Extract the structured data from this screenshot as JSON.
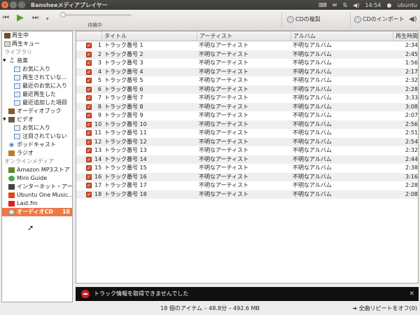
{
  "window": {
    "title": "Bansheeメディアプレイヤー"
  },
  "tray": {
    "time": "14:54",
    "user": "ubuntu"
  },
  "toolbar": {
    "status": "待機中",
    "copy_cd": "CDの複製",
    "import_cd": "CDのインポート"
  },
  "sidebar": {
    "now_playing": "再生中",
    "play_queue": "再生キュー",
    "library_header": "ライブラリ",
    "music": "音楽",
    "music_items": [
      "お気に入り",
      "再生されていな...",
      "最近のお気に入り",
      "最近再生した",
      "最近追加した項目"
    ],
    "audiobooks": "オーディオブック",
    "video": "ビデオ",
    "video_items": [
      "お気に入り",
      "注目されていない"
    ],
    "podcast": "ポッドキャスト",
    "radio": "ラジオ",
    "online_header": "オンラインメディア",
    "online_items": [
      "Amazon MP3ストア",
      "Miro Guide",
      "インターネット・アー...",
      "Ubuntu One Music...",
      "Last.fm"
    ],
    "audio_cd": "オーディオCD",
    "audio_cd_count": "18"
  },
  "table": {
    "columns": [
      "タイトル",
      "アーティスト",
      "アルバム",
      "再生時間"
    ],
    "rows": [
      {
        "n": "1",
        "title": "トラック番号 1",
        "artist": "不明なアーティスト",
        "album": "不明なアルバム",
        "time": "2:34"
      },
      {
        "n": "2",
        "title": "トラック番号 2",
        "artist": "不明なアーティスト",
        "album": "不明なアルバム",
        "time": "2:45"
      },
      {
        "n": "3",
        "title": "トラック番号 3",
        "artist": "不明なアーティスト",
        "album": "不明なアルバム",
        "time": "1:56"
      },
      {
        "n": "4",
        "title": "トラック番号 4",
        "artist": "不明なアーティスト",
        "album": "不明なアルバム",
        "time": "2:17"
      },
      {
        "n": "5",
        "title": "トラック番号 5",
        "artist": "不明なアーティスト",
        "album": "不明なアルバム",
        "time": "2:32"
      },
      {
        "n": "6",
        "title": "トラック番号 6",
        "artist": "不明なアーティスト",
        "album": "不明なアルバム",
        "time": "2:28"
      },
      {
        "n": "7",
        "title": "トラック番号 7",
        "artist": "不明なアーティスト",
        "album": "不明なアルバム",
        "time": "3:33"
      },
      {
        "n": "8",
        "title": "トラック番号 8",
        "artist": "不明なアーティスト",
        "album": "不明なアルバム",
        "time": "3:08"
      },
      {
        "n": "9",
        "title": "トラック番号 9",
        "artist": "不明なアーティスト",
        "album": "不明なアルバム",
        "time": "2:07"
      },
      {
        "n": "10",
        "title": "トラック番号 10",
        "artist": "不明なアーティスト",
        "album": "不明なアルバム",
        "time": "2:56"
      },
      {
        "n": "11",
        "title": "トラック番号 11",
        "artist": "不明なアーティスト",
        "album": "不明なアルバム",
        "time": "2:51"
      },
      {
        "n": "12",
        "title": "トラック番号 12",
        "artist": "不明なアーティスト",
        "album": "不明なアルバム",
        "time": "2:54"
      },
      {
        "n": "13",
        "title": "トラック番号 13",
        "artist": "不明なアーティスト",
        "album": "不明なアルバム",
        "time": "2:32"
      },
      {
        "n": "14",
        "title": "トラック番号 14",
        "artist": "不明なアーティスト",
        "album": "不明なアルバム",
        "time": "2:44"
      },
      {
        "n": "15",
        "title": "トラック番号 15",
        "artist": "不明なアーティスト",
        "album": "不明なアルバム",
        "time": "2:38"
      },
      {
        "n": "16",
        "title": "トラック番号 16",
        "artist": "不明なアーティスト",
        "album": "不明なアルバム",
        "time": "3:16"
      },
      {
        "n": "17",
        "title": "トラック番号 17",
        "artist": "不明なアーティスト",
        "album": "不明なアルバム",
        "time": "2:28"
      },
      {
        "n": "18",
        "title": "トラック番号 18",
        "artist": "不明なアーティスト",
        "album": "不明なアルバム",
        "time": "2:08"
      }
    ]
  },
  "error": {
    "message": "トラック情報を取得できませんでした"
  },
  "statusbar": {
    "summary": "18 個のアイテム – 48.8分 – 492.6 MB",
    "repeat": "全曲リピートをオフ(0)"
  },
  "colors": {
    "accent": "#f07746",
    "checkbox": "#d64b2b",
    "panel": "#3c3b37"
  }
}
